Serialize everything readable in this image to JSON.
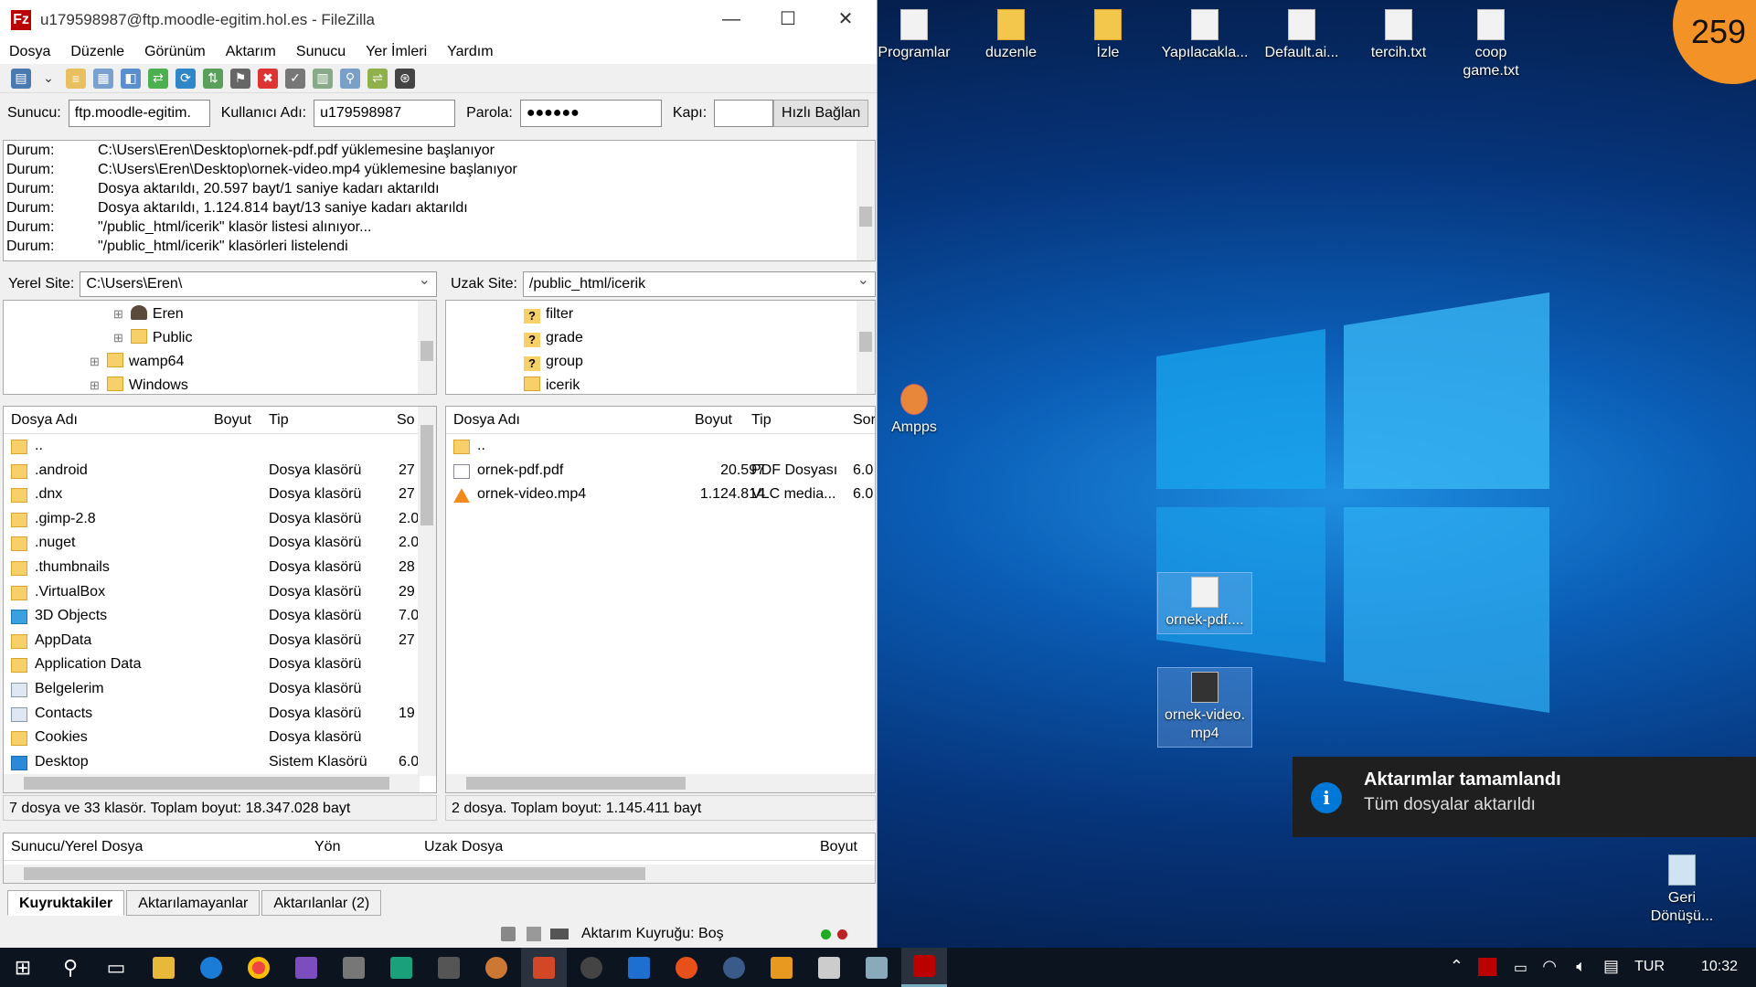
{
  "window": {
    "title": "u179598987@ftp.moodle-egitim.hol.es - FileZilla",
    "logo_letter": "Fz"
  },
  "menu": [
    "Dosya",
    "Düzenle",
    "Görünüm",
    "Aktarım",
    "Sunucu",
    "Yer İmleri",
    "Yardım"
  ],
  "quickconnect": {
    "host_label": "Sunucu:",
    "host_value": "ftp.moodle-egitim.",
    "user_label": "Kullanıcı Adı:",
    "user_value": "u179598987",
    "pass_label": "Parola:",
    "pass_value": "●●●●●●",
    "port_label": "Kapı:",
    "port_value": "",
    "button": "Hızlı Bağlan"
  },
  "log": [
    {
      "k": "Durum:",
      "v": "C:\\Users\\Eren\\Desktop\\ornek-pdf.pdf yüklemesine başlanıyor"
    },
    {
      "k": "Durum:",
      "v": "C:\\Users\\Eren\\Desktop\\ornek-video.mp4 yüklemesine başlanıyor"
    },
    {
      "k": "Durum:",
      "v": "Dosya aktarıldı, 20.597 bayt/1 saniye kadarı aktarıldı"
    },
    {
      "k": "Durum:",
      "v": "Dosya aktarıldı, 1.124.814 bayt/13 saniye kadarı aktarıldı"
    },
    {
      "k": "Durum:",
      "v": "\"/public_html/icerik\" klasör listesi alınıyor..."
    },
    {
      "k": "Durum:",
      "v": "\"/public_html/icerik\" klasörleri listelendi"
    }
  ],
  "local": {
    "site_label": "Yerel Site:",
    "site_value": "C:\\Users\\Eren\\",
    "tree": [
      "Eren",
      "Public",
      "wamp64",
      "Windows"
    ],
    "headers": {
      "name": "Dosya Adı",
      "size": "Boyut",
      "type": "Tip",
      "date": "So"
    },
    "files": [
      {
        "name": "..",
        "type": "",
        "date": ""
      },
      {
        "name": ".android",
        "type": "Dosya klasörü",
        "date": "27"
      },
      {
        "name": ".dnx",
        "type": "Dosya klasörü",
        "date": "27"
      },
      {
        "name": ".gimp-2.8",
        "type": "Dosya klasörü",
        "date": "2.0"
      },
      {
        "name": ".nuget",
        "type": "Dosya klasörü",
        "date": "2.0"
      },
      {
        "name": ".thumbnails",
        "type": "Dosya klasörü",
        "date": "28"
      },
      {
        "name": ".VirtualBox",
        "type": "Dosya klasörü",
        "date": "29"
      },
      {
        "name": "3D Objects",
        "type": "Dosya klasörü",
        "date": "7.0"
      },
      {
        "name": "AppData",
        "type": "Dosya klasörü",
        "date": "27"
      },
      {
        "name": "Application Data",
        "type": "Dosya klasörü",
        "date": ""
      },
      {
        "name": "Belgelerim",
        "type": "Dosya klasörü",
        "date": ""
      },
      {
        "name": "Contacts",
        "type": "Dosya klasörü",
        "date": "19"
      },
      {
        "name": "Cookies",
        "type": "Dosya klasörü",
        "date": ""
      },
      {
        "name": "Desktop",
        "type": "Sistem Klasörü",
        "date": "6.0"
      }
    ],
    "status": "7 dosya ve 33 klasör. Toplam boyut: 18.347.028 bayt"
  },
  "remote": {
    "site_label": "Uzak Site:",
    "site_value": "/public_html/icerik",
    "tree": [
      "filter",
      "grade",
      "group",
      "icerik"
    ],
    "headers": {
      "name": "Dosya Adı",
      "size": "Boyut",
      "type": "Tip",
      "date": "Sor"
    },
    "files": [
      {
        "name": "..",
        "size": "",
        "type": "",
        "date": ""
      },
      {
        "name": "ornek-pdf.pdf",
        "size": "20.597",
        "type": "PDF Dosyası",
        "date": "6.0"
      },
      {
        "name": "ornek-video.mp4",
        "size": "1.124.814",
        "type": "VLC media...",
        "date": "6.0"
      }
    ],
    "status": "2 dosya. Toplam boyut: 1.145.411 bayt"
  },
  "queue": {
    "h1": "Sunucu/Yerel Dosya",
    "h2": "Yön",
    "h3": "Uzak Dosya",
    "h4": "Boyut"
  },
  "tabs": [
    "Kuyruktakiler",
    "Aktarılamayanlar",
    "Aktarılanlar (2)"
  ],
  "bottom_status": "Aktarım Kuyruğu: Boş",
  "desktop": {
    "icons": [
      "Programlar",
      "duzenle",
      "İzle",
      "Yapılacakla...",
      "Default.ai...",
      "tercih.txt",
      "coop game.txt"
    ],
    "ampps": "Ampps",
    "pdf_icon": "ornek-pdf....",
    "video_icon": "ornek-video.\nmp4",
    "recycle": "Geri Dönüşü...",
    "badge": "259"
  },
  "toast": {
    "title": "Aktarımlar tamamlandı",
    "body": "Tüm dosyalar aktarıldı",
    "icon": "i"
  },
  "tray": {
    "lang": "TUR",
    "time": "10:32"
  }
}
